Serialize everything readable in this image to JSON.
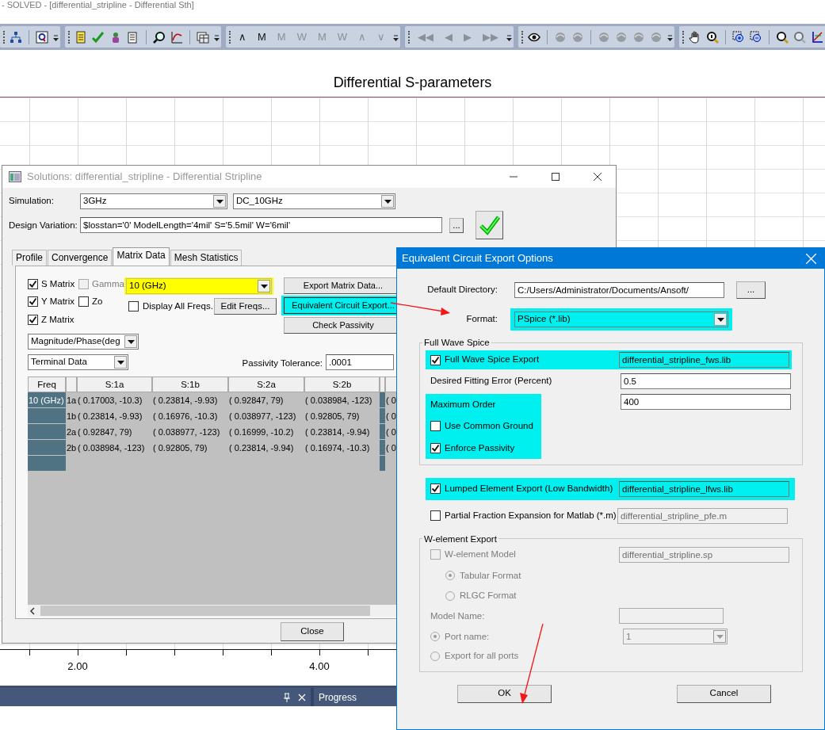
{
  "app": {
    "title": "- SOLVED - [differential_stripline - Differential Sth]"
  },
  "toolbars": [
    {
      "items": [
        {
          "kind": "icon",
          "disabled": false
        },
        {
          "kind": "separator"
        },
        {
          "kind": "icon",
          "disabled": false
        }
      ]
    },
    {
      "items": [
        {
          "kind": "icon",
          "disabled": false
        },
        {
          "kind": "icon",
          "disabled": false
        },
        {
          "kind": "icon",
          "disabled": false
        },
        {
          "kind": "icon",
          "disabled": false
        },
        {
          "kind": "separator"
        },
        {
          "kind": "icon",
          "disabled": false
        },
        {
          "kind": "icon",
          "disabled": false
        },
        {
          "kind": "separator"
        },
        {
          "kind": "icon",
          "disabled": false
        }
      ]
    },
    {
      "items": [
        {
          "kind": "glyph",
          "text": "∧",
          "disabled": false
        },
        {
          "kind": "glyph",
          "text": "M",
          "disabled": false
        },
        {
          "kind": "glyph",
          "text": "M",
          "disabled": true
        },
        {
          "kind": "glyph",
          "text": "W",
          "disabled": true
        },
        {
          "kind": "glyph",
          "text": "M",
          "disabled": true
        },
        {
          "kind": "glyph",
          "text": "W",
          "disabled": true
        },
        {
          "kind": "glyph",
          "text": "∧",
          "disabled": true
        },
        {
          "kind": "glyph",
          "text": "∨",
          "disabled": true
        }
      ]
    },
    {
      "items": [
        {
          "kind": "glyph",
          "text": "◀◀",
          "disabled": true
        },
        {
          "kind": "glyph",
          "text": "◀",
          "disabled": true
        },
        {
          "kind": "glyph",
          "text": "▶",
          "disabled": true
        },
        {
          "kind": "glyph",
          "text": "▶▶",
          "disabled": true
        }
      ]
    },
    {
      "items": [
        {
          "kind": "icon",
          "disabled": false
        },
        {
          "kind": "separator"
        },
        {
          "kind": "icon",
          "disabled": true
        },
        {
          "kind": "icon",
          "disabled": true
        },
        {
          "kind": "separator"
        },
        {
          "kind": "icon",
          "disabled": true
        },
        {
          "kind": "icon",
          "disabled": true
        },
        {
          "kind": "icon",
          "disabled": true
        },
        {
          "kind": "icon",
          "disabled": true
        }
      ]
    },
    {
      "items": [
        {
          "kind": "icon",
          "disabled": false
        },
        {
          "kind": "icon",
          "disabled": false
        },
        {
          "kind": "separator"
        },
        {
          "kind": "icon",
          "disabled": false
        },
        {
          "kind": "icon",
          "disabled": false
        },
        {
          "kind": "separator"
        },
        {
          "kind": "icon",
          "disabled": false
        },
        {
          "kind": "icon",
          "disabled": true
        },
        {
          "kind": "icon",
          "disabled": false
        }
      ]
    }
  ],
  "plot": {
    "title": "Differential S-parameters",
    "x_labels": [
      "2.00",
      "4.00"
    ]
  },
  "dock": {
    "panel_title": "Progress"
  },
  "solutions_dialog": {
    "title": "Solutions: differential_stripline - Differential Stripline",
    "simulation": {
      "label": "Simulation:",
      "setup": "3GHz",
      "sweep": "DC_10GHz"
    },
    "design_variation": {
      "label": "Design Variation:",
      "value": "$losstan='0' ModelLength='4mil' S='5.5mil' W='6mil'",
      "browse": "..."
    },
    "tabs": [
      {
        "label": "Profile",
        "selected": false
      },
      {
        "label": "Convergence",
        "selected": false
      },
      {
        "label": "Matrix Data",
        "selected": true
      },
      {
        "label": "Mesh Statistics",
        "selected": false
      }
    ],
    "matrix_options": [
      {
        "label": "S Matrix",
        "checked": true,
        "disabled": false
      },
      {
        "label": "Gamma",
        "checked": false,
        "disabled": true
      },
      {
        "label": "Y Matrix",
        "checked": true,
        "disabled": false
      },
      {
        "label": "Zo",
        "checked": false,
        "disabled": false
      },
      {
        "label": "Z Matrix",
        "checked": true,
        "disabled": false
      }
    ],
    "frequency": {
      "value": "10 (GHz)",
      "highlighted": true
    },
    "display_all": {
      "label": "Display All Freqs.",
      "checked": false
    },
    "edit_freqs": "Edit Freqs...",
    "actions": [
      {
        "label": "Export Matrix Data...",
        "highlighted": false
      },
      {
        "label": "Equivalent Circuit Export...",
        "highlighted": true
      },
      {
        "label": "Check Passivity",
        "highlighted": false
      }
    ],
    "value_format": "Magnitude/Phase(deg",
    "data_type": "Terminal Data",
    "passivity": {
      "label": "Passivity Tolerance:",
      "value": ".0001"
    },
    "table": {
      "freq_header": "Freq",
      "columns": [
        "S:1a",
        "S:1b",
        "S:2a",
        "S:2b"
      ],
      "rows": [
        {
          "freq": "10 (GHz)",
          "port": "1a",
          "cells": [
            "( 0.17003, -10.3)",
            "( 0.23814, -9.93)",
            "( 0.92847, 79)",
            "( 0.038984, -123)"
          ],
          "cut": "( 0."
        },
        {
          "port": "1b",
          "cells": [
            "( 0.23814, -9.93)",
            "( 0.16976, -10.3)",
            "( 0.038977, -123)",
            "( 0.92805, 79)"
          ],
          "cut": "( 0."
        },
        {
          "port": "2a",
          "cells": [
            "( 0.92847, 79)",
            "( 0.038977, -123)",
            "( 0.16999, -10.2)",
            "( 0.23814, -9.94)"
          ],
          "cut": "( 0."
        },
        {
          "port": "2b",
          "cells": [
            "( 0.038984, -123)",
            "( 0.92805, 79)",
            "( 0.23814, -9.94)",
            "( 0.16974, -10.3)"
          ],
          "cut": "( 0."
        }
      ]
    },
    "close": "Close"
  },
  "export_dialog": {
    "title": "Equivalent Circuit Export Options",
    "directory": {
      "label": "Default Directory:",
      "value": "C:/Users/Administrator/Documents/Ansoft/",
      "browse": "..."
    },
    "format": {
      "label": "Format:",
      "value": "PSpice (*.lib)",
      "highlighted": true
    },
    "full_wave": {
      "legend": "Full Wave Spice",
      "export": {
        "label": "Full Wave Spice Export",
        "checked": true,
        "value": "differential_stripline_fws.lib",
        "highlighted": true
      },
      "fitting_error": {
        "label": "Desired Fitting Error (Percent)",
        "value": "0.5"
      },
      "max_order": {
        "label": "Maximum Order",
        "value": "400",
        "highlighted": true
      },
      "options": [
        {
          "label": "Use Common Ground",
          "checked": false
        },
        {
          "label": "Enforce Passivity",
          "checked": true
        }
      ]
    },
    "lumped": {
      "label": "Lumped Element Export (Low Bandwidth)",
      "checked": true,
      "value": "differential_stripline_lfws.lib",
      "highlighted": true
    },
    "partial": {
      "label": "Partial Fraction Expansion for Matlab (*.m)",
      "checked": false,
      "value": "differential_stripline_pfe.m"
    },
    "w_element": {
      "legend": "W-element Export",
      "disabled": true,
      "model": {
        "label": "W-element Model",
        "checked": false,
        "value": "differential_stripline.sp"
      },
      "formats": [
        {
          "label": "Tabular Format",
          "selected": true
        },
        {
          "label": "RLGC Format",
          "selected": false
        }
      ],
      "model_name": {
        "label": "Model Name:"
      },
      "ports": [
        {
          "label": "Port name:",
          "selected": true
        },
        {
          "label": "Export for all ports",
          "selected": false
        }
      ],
      "port_value": "1"
    },
    "buttons": [
      {
        "label": "OK"
      },
      {
        "label": "Cancel"
      }
    ]
  }
}
